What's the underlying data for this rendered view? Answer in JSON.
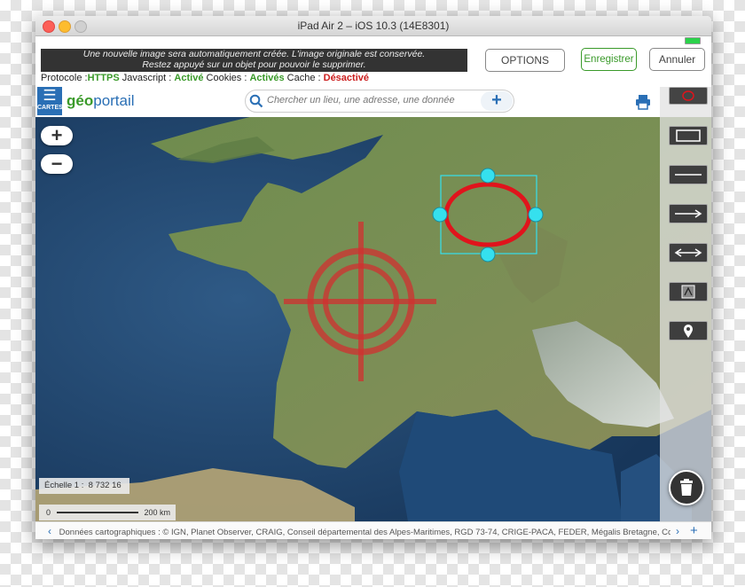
{
  "window": {
    "title": "iPad Air 2 – iOS 10.3 (14E8301)"
  },
  "notice": {
    "line1": "Une nouvelle image sera automatiquement créée. L'image originale est conservée.",
    "line2": "Restez appuyé sur un objet pour pouvoir le supprimer."
  },
  "actions": {
    "options": "OPTIONS",
    "save": "Enregistrer",
    "cancel": "Annuler"
  },
  "protocol": {
    "protocol_label": "Protocole :",
    "protocol_value": "HTTPS",
    "javascript_label": "Javascript :",
    "javascript_value": "Activé",
    "cookies_label": "Cookies :",
    "cookies_value": "Activés",
    "cache_label": "Cache :",
    "cache_value": "Désactivé"
  },
  "header": {
    "menu_label": "CARTES",
    "logo_geo": "géo",
    "logo_portail": "portail",
    "search_placeholder": "Chercher un lieu, une adresse, une donnée"
  },
  "map": {
    "zoom_in": "+",
    "zoom_out": "−",
    "scale_label": "Échelle 1 :",
    "scale_value": "8 732 16",
    "scalebar_start": "0",
    "scalebar_end": "200 km"
  },
  "tools": [
    "ellipse-tool",
    "rectangle-tool",
    "line-tool",
    "arrow-tool",
    "double-arrow-tool",
    "text-tool",
    "marker-tool"
  ],
  "footer": {
    "attribution": "Données cartographiques : ©  IGN,  Planet Observer,  CRAIG,  Conseil départemental des Alpes-Maritimes,  RGD 73-74,  CRIGE-PACA,  FEDER,  Mégalis Bretagne,  Colle"
  },
  "colors": {
    "accent": "#2a6fb5",
    "green": "#3a9a2a",
    "status_red": "#cc2020",
    "annotation_red": "#e0141c",
    "handle_cyan": "#35e0ee"
  }
}
